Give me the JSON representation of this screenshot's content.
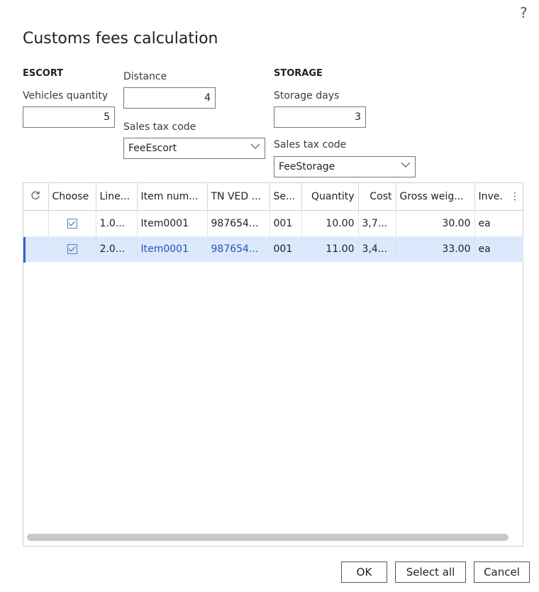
{
  "dialog": {
    "help_glyph": "?",
    "title": "Customs fees calculation"
  },
  "escort": {
    "header": "ESCORT",
    "vehicles_label": "Vehicles quantity",
    "vehicles_value": "5",
    "distance_label": "Distance",
    "distance_value": "4",
    "tax_label": "Sales tax code",
    "tax_value": "FeeEscort"
  },
  "storage": {
    "header": "STORAGE",
    "days_label": "Storage days",
    "days_value": "3",
    "tax_label": "Sales tax code",
    "tax_value": "FeeStorage"
  },
  "grid": {
    "refresh_icon": "refresh-icon",
    "columns": [
      "Choose",
      "Line...",
      "Item num...",
      "TN VED ...",
      "Se...",
      "Quantity",
      "Cost",
      "Gross weig...",
      "Inve."
    ],
    "more_glyph": "⋮",
    "rows": [
      {
        "checked": true,
        "line": "1.0...",
        "item": "Item0001",
        "tnved": "987654...",
        "series": "001",
        "quantity": "10.00",
        "cost": "3,7...",
        "gross": "30.00",
        "unit": "ea"
      },
      {
        "checked": true,
        "line": "2.0...",
        "item": "Item0001",
        "tnved": "987654...",
        "series": "001",
        "quantity": "11.00",
        "cost": "3,4...",
        "gross": "33.00",
        "unit": "ea"
      }
    ]
  },
  "buttons": {
    "ok": "OK",
    "select_all": "Select all",
    "cancel": "Cancel"
  },
  "colors": {
    "accent": "#2d64d0",
    "selected_row": "#dce8fb",
    "link": "#1e56b5"
  }
}
